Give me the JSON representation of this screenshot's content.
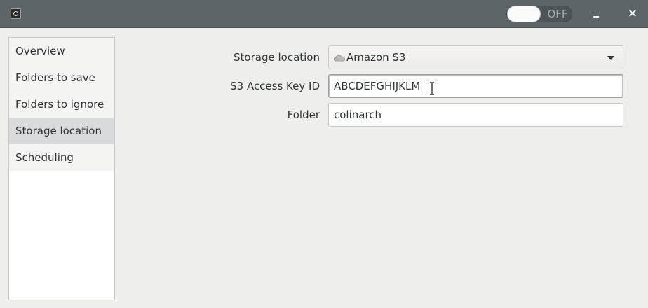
{
  "titlebar": {
    "app_icon": "camera-icon",
    "toggle_state": "OFF",
    "minimize_icon": "minimize-icon",
    "close_label": "✕"
  },
  "sidebar": {
    "items": [
      {
        "label": "Overview"
      },
      {
        "label": "Folders to save"
      },
      {
        "label": "Folders to ignore"
      },
      {
        "label": "Storage location",
        "selected": true
      },
      {
        "label": "Scheduling"
      }
    ]
  },
  "form": {
    "storage_location": {
      "label": "Storage location",
      "value": "Amazon S3",
      "icon": "cloud-icon"
    },
    "access_key": {
      "label": "S3 Access Key ID",
      "value": "ABCDEFGHIJKLM"
    },
    "folder": {
      "label": "Folder",
      "value": "colinarch"
    }
  },
  "colors": {
    "titlebar": "#5d6568",
    "background": "#eeeeec",
    "selected_item": "#d9dadb"
  }
}
